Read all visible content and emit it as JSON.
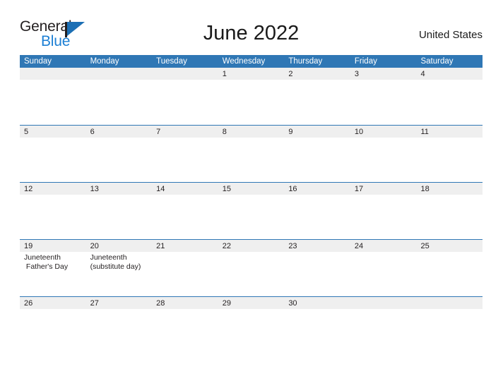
{
  "brand": {
    "name_top": "General",
    "name_bottom": "Blue",
    "flag_icon": "flag-triangle-icon",
    "color_blue": "#1c7fd4",
    "color_flag": "#1c6fb4",
    "color_dark": "#231f20"
  },
  "header": {
    "title": "June 2022",
    "country": "United States"
  },
  "calendar": {
    "header_bg": "#2f77b5",
    "row_band_bg": "#efefef",
    "row_rule": "#2f77b5",
    "weekdays": [
      "Sunday",
      "Monday",
      "Tuesday",
      "Wednesday",
      "Thursday",
      "Friday",
      "Saturday"
    ],
    "weeks": [
      [
        {
          "day": ""
        },
        {
          "day": ""
        },
        {
          "day": ""
        },
        {
          "day": "1",
          "events": []
        },
        {
          "day": "2",
          "events": []
        },
        {
          "day": "3",
          "events": []
        },
        {
          "day": "4",
          "events": []
        }
      ],
      [
        {
          "day": "5",
          "events": []
        },
        {
          "day": "6",
          "events": []
        },
        {
          "day": "7",
          "events": []
        },
        {
          "day": "8",
          "events": []
        },
        {
          "day": "9",
          "events": []
        },
        {
          "day": "10",
          "events": []
        },
        {
          "day": "11",
          "events": []
        }
      ],
      [
        {
          "day": "12",
          "events": []
        },
        {
          "day": "13",
          "events": []
        },
        {
          "day": "14",
          "events": []
        },
        {
          "day": "15",
          "events": []
        },
        {
          "day": "16",
          "events": []
        },
        {
          "day": "17",
          "events": []
        },
        {
          "day": "18",
          "events": []
        }
      ],
      [
        {
          "day": "19",
          "events": [
            "Juneteenth",
            " Father's Day"
          ]
        },
        {
          "day": "20",
          "events": [
            "Juneteenth",
            "(substitute day)"
          ]
        },
        {
          "day": "21",
          "events": []
        },
        {
          "day": "22",
          "events": []
        },
        {
          "day": "23",
          "events": []
        },
        {
          "day": "24",
          "events": []
        },
        {
          "day": "25",
          "events": []
        }
      ],
      [
        {
          "day": "26",
          "events": []
        },
        {
          "day": "27",
          "events": []
        },
        {
          "day": "28",
          "events": []
        },
        {
          "day": "29",
          "events": []
        },
        {
          "day": "30",
          "events": []
        },
        {
          "day": ""
        },
        {
          "day": ""
        }
      ]
    ]
  }
}
